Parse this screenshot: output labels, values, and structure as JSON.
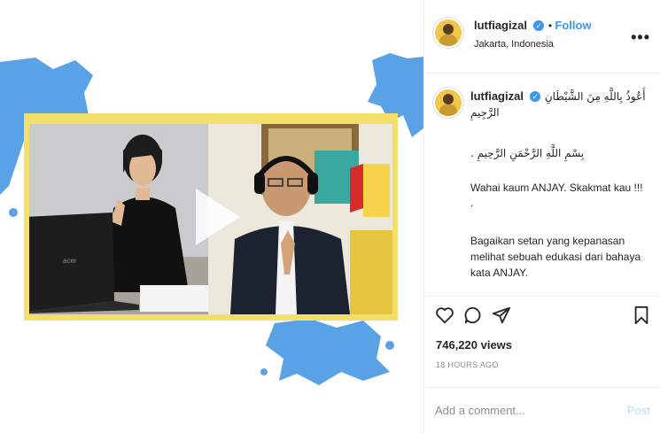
{
  "post": {
    "username": "lutfiagizal",
    "follow_label": "Follow",
    "location": "Jakarta, Indonesia",
    "more_label": "•••"
  },
  "caption": {
    "username": "lutfiagizal",
    "line1": "أَعُوذُ بِاللَّهِ مِنَ الشَّيْطَانِ",
    "line2": "الرَّجِيمِ",
    "line3": "بِسْمِ اللَّهِ الرَّحْمَنِ الرَّحِيمِ .",
    "line4": "Wahai kaum ANJAY. Skakmat kau !!!",
    "line5": ".",
    "line6": "Bagaikan setan yang kepanasan",
    "line7": "melihat sebuah edukasi dari bahaya",
    "line8": "kata ANJAY."
  },
  "video": {
    "laptop_brand": "acer"
  },
  "stats": {
    "views": "746,220 views",
    "timestamp": "18 HOURS AGO"
  },
  "comment": {
    "placeholder": "Add a comment...",
    "post_label": "Post"
  },
  "colors": {
    "splash": "#5aa2e6",
    "frame": "#f3e06a",
    "link": "#3897f0",
    "post_disabled": "#b2dffc"
  },
  "icons": [
    "heart-icon",
    "comment-icon",
    "share-icon",
    "bookmark-icon",
    "play-icon",
    "verified-icon",
    "more-icon"
  ]
}
